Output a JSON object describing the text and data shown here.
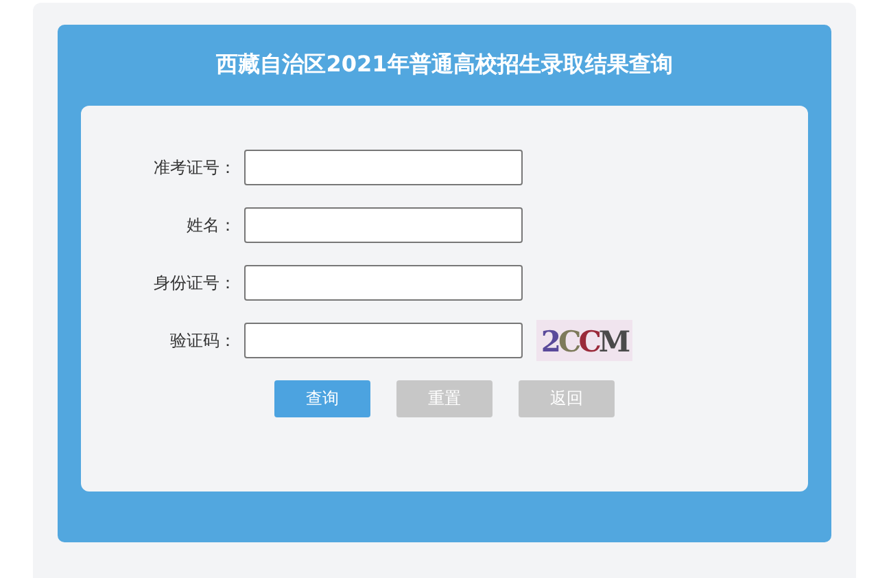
{
  "title": "西藏自治区2021年普通高校招生录取结果查询",
  "fields": [
    {
      "label": "准考证号：",
      "kind": "text"
    },
    {
      "label": "姓名：",
      "kind": "text"
    },
    {
      "label": "身份证号：",
      "kind": "text"
    },
    {
      "label": "验证码：",
      "kind": "captcha",
      "captcha": "2CCM"
    }
  ],
  "buttons": [
    {
      "label": "查询",
      "kind": "primary"
    },
    {
      "label": "重置",
      "kind": "secondary"
    },
    {
      "label": "返回",
      "kind": "secondary"
    }
  ]
}
